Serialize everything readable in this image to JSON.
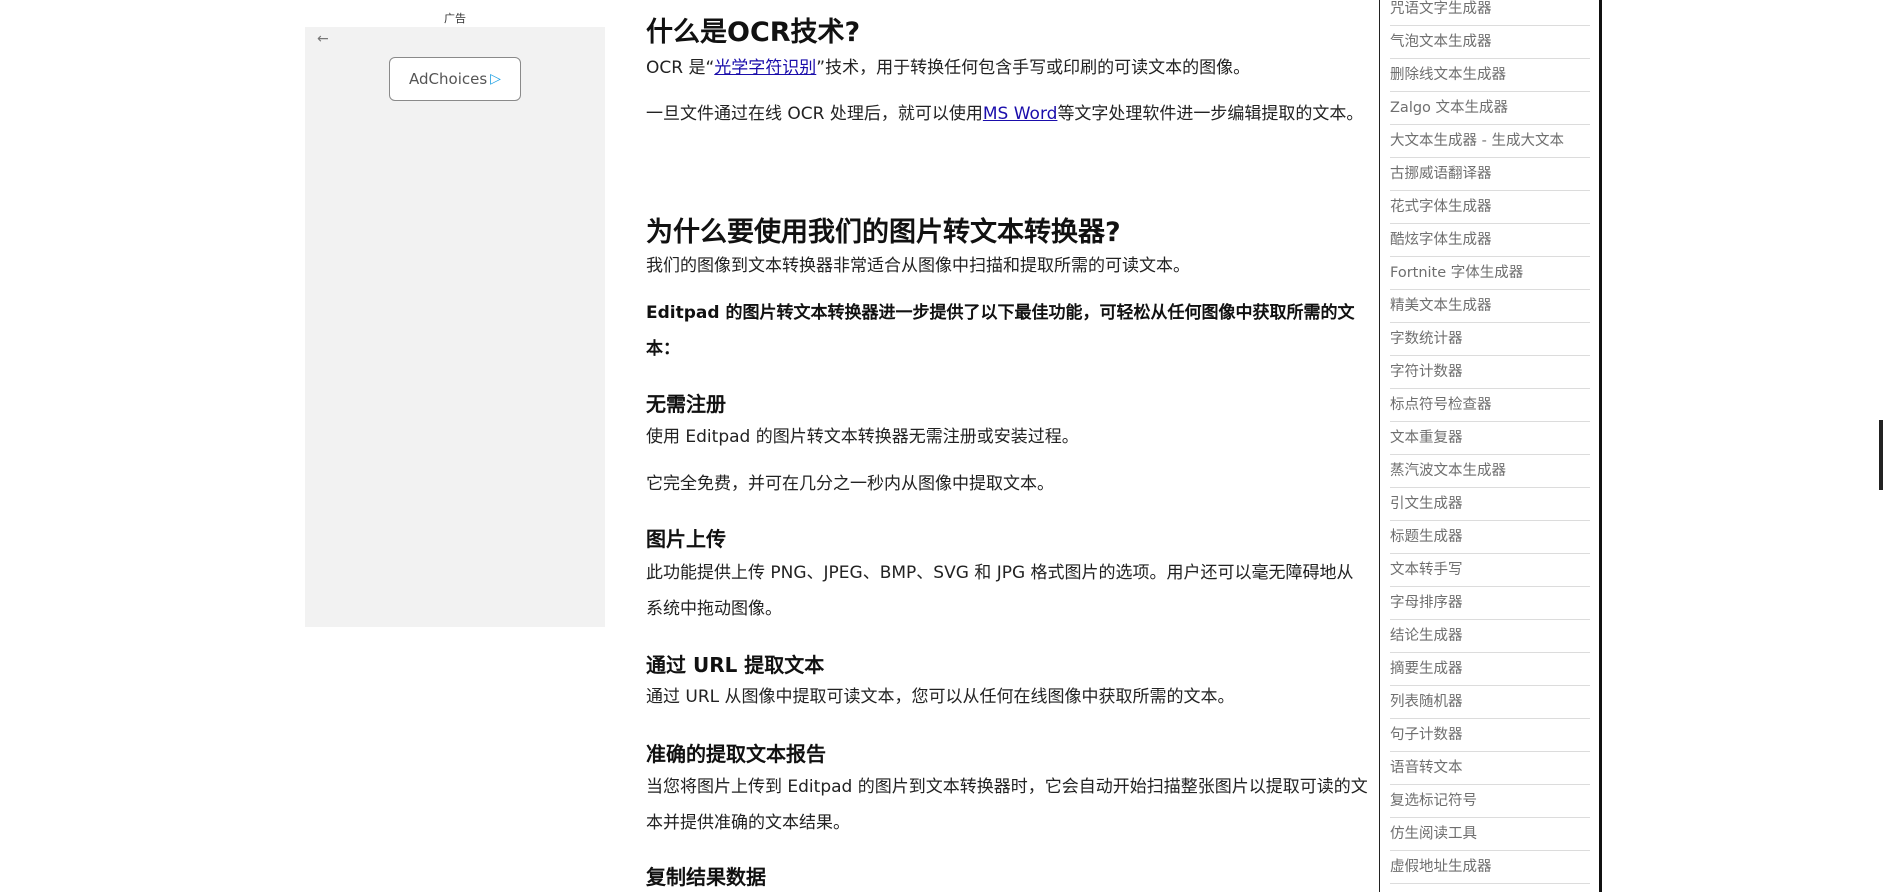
{
  "ad": {
    "label": "广告",
    "back_icon_glyph": "←",
    "adchoices_label": "AdChoices",
    "adchoices_icon_glyph": "▷"
  },
  "article": {
    "h_ocr": "什么是OCR技术?",
    "p_ocr_1_before": "OCR 是“",
    "p_ocr_1_link": "光学字符识别",
    "p_ocr_1_after": "”技术，用于转换任何包含手写或印刷的可读文本的图像。",
    "p_ocr_2_before": "一旦文件通过在线 OCR 处理后，就可以使用",
    "p_ocr_2_link": "MS Word",
    "p_ocr_2_after": "等文字处理软件进一步编辑提取的文本。",
    "h_why": "为什么要使用我们的图片转文本转换器?",
    "p_why_1": "我们的图像到文本转换器非常适合从图像中扫描和提取所需的可读文本。",
    "p_why_2": "Editpad 的图片转文本转换器进一步提供了以下最佳功能，可轻松从任何图像中获取所需的文本：",
    "h_noreg": "无需注册",
    "p_noreg_1": "使用 Editpad 的图片转文本转换器无需注册或安装过程。",
    "p_noreg_2": "它完全免费，并可在几分之一秒内从图像中提取文本。",
    "h_upload": "图片上传",
    "p_upload": "此功能提供上传 PNG、JPEG、BMP、SVG 和 JPG 格式图片的选项。用户还可以毫无障碍地从系统中拖动图像。",
    "h_url": "通过 URL 提取文本",
    "p_url": "通过 URL 从图像中提取可读文本，您可以从任何在线图像中获取所需的文本。",
    "h_report": "准确的提取文本报告",
    "p_report": "当您将图片上传到 Editpad 的图片到文本转换器时，它会自动开始扫描整张图片以提取可读的文本并提供准确的文本结果。",
    "h_copy": "复制结果数据"
  },
  "sidebar": {
    "items": [
      "咒语文字生成器",
      "气泡文本生成器",
      "删除线文本生成器",
      "Zalgo 文本生成器",
      "大文本生成器 - 生成大文本",
      "古挪威语翻译器",
      "花式字体生成器",
      "酷炫字体生成器",
      "Fortnite 字体生成器",
      "精美文本生成器",
      "字数统计器",
      "字符计数器",
      "标点符号检查器",
      "文本重复器",
      "蒸汽波文本生成器",
      "引文生成器",
      "标题生成器",
      "文本转手写",
      "字母排序器",
      "结论生成器",
      "摘要生成器",
      "列表随机器",
      "句子计数器",
      "语音转文本",
      "复选标记符号",
      "仿生阅读工具",
      "虚假地址生成器"
    ]
  }
}
